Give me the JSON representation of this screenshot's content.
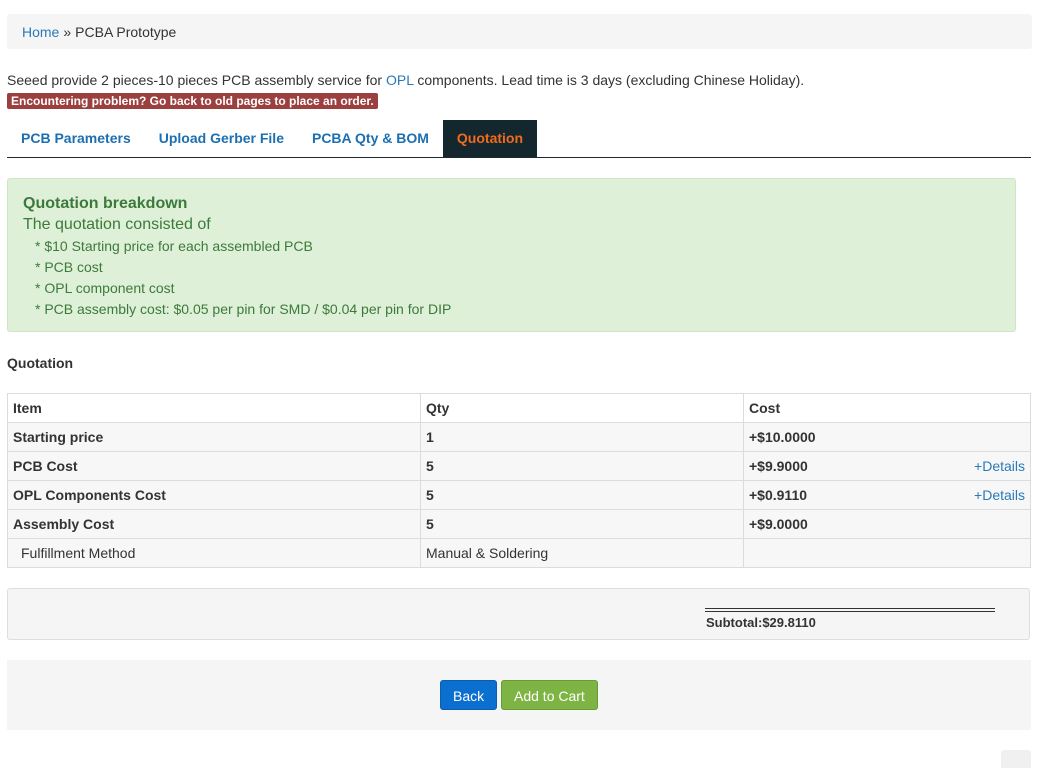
{
  "breadcrumb": {
    "home": "Home",
    "separator": "»",
    "current": "PCBA Prototype"
  },
  "intro": {
    "before_link": "Seeed provide 2 pieces-10 pieces PCB assembly service for ",
    "link": "OPL",
    "after_link": " components. Lead time is 3 days (excluding Chinese Holiday)."
  },
  "warning_badge": "Encountering problem? Go back to old pages to place an order.",
  "tabs": [
    {
      "label": "PCB Parameters"
    },
    {
      "label": "Upload Gerber File"
    },
    {
      "label": "PCBA Qty & BOM"
    },
    {
      "label": "Quotation"
    }
  ],
  "active_tab": "Quotation",
  "breakdown": {
    "title": "Quotation breakdown",
    "subtitle": "The quotation consisted of",
    "items": [
      "* $10 Starting price for each assembled PCB",
      "* PCB cost",
      "* OPL component cost",
      "* PCB assembly cost: $0.05 per pin for SMD / $0.04 per pin for DIP"
    ]
  },
  "quotation": {
    "title": "Quotation",
    "headers": {
      "item": "Item",
      "qty": "Qty",
      "cost": "Cost"
    },
    "rows": [
      {
        "item": "Starting price",
        "qty": "1",
        "cost": "+$10.0000"
      },
      {
        "item": "PCB Cost",
        "qty": "5",
        "cost": "+$9.9000",
        "details": "+Details"
      },
      {
        "item": "OPL Components Cost",
        "qty": "5",
        "cost": "+$0.9110",
        "details": "+Details"
      },
      {
        "item": "Assembly Cost",
        "qty": "5",
        "cost": "+$9.0000"
      }
    ],
    "fulfillment": {
      "label": "Fulfillment Method",
      "value": "Manual & Soldering"
    }
  },
  "subtotal": "Subtotal:$29.8110",
  "buttons": {
    "back": "Back",
    "add_to_cart": "Add to Cart"
  },
  "colors": {
    "active_tab_bg": "#14262e",
    "active_tab_text": "#f26b1d",
    "tab_text": "#1d6fb0",
    "alert_bg": "#dff0d8",
    "alert_text": "#3c7a3c",
    "badge_bg": "#9b3f3f",
    "back_button": "#0b6fd0",
    "cart_button": "#7db443"
  }
}
